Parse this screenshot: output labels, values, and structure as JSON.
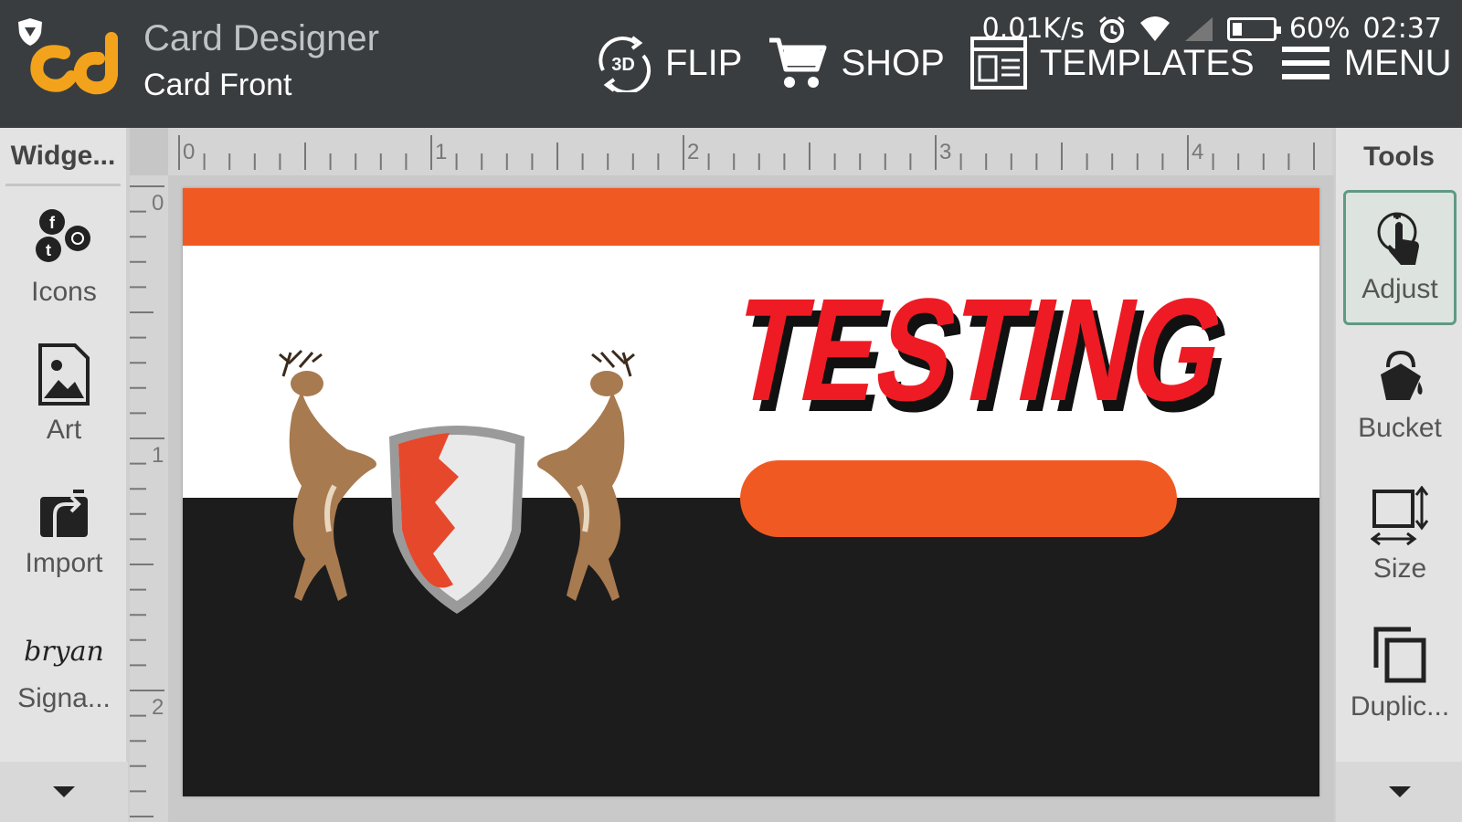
{
  "status": {
    "net_speed": "0.01K/s",
    "battery": "60%",
    "time": "02:37",
    "icons": [
      "shield-icon",
      "alarm-icon",
      "wifi-icon",
      "signal-icon",
      "battery-icon"
    ]
  },
  "app": {
    "title": "Card Designer",
    "subtitle": "Card Front"
  },
  "actions": {
    "flip": "FLIP",
    "flip_badge": "3D",
    "shop": "SHOP",
    "templates": "TEMPLATES",
    "menu": "MENU"
  },
  "widgets": {
    "header": "Widge...",
    "items": [
      {
        "label": "Icons",
        "icon": "social-icons-icon"
      },
      {
        "label": "Art",
        "icon": "image-icon"
      },
      {
        "label": "Import",
        "icon": "import-icon"
      },
      {
        "label": "Signa...",
        "icon": "signature-icon",
        "preview": "bryan"
      }
    ]
  },
  "tools": {
    "header": "Tools",
    "items": [
      {
        "label": "Adjust",
        "icon": "touch-adjust-icon",
        "active": true
      },
      {
        "label": "Bucket",
        "icon": "paint-bucket-icon"
      },
      {
        "label": "Size",
        "icon": "resize-icon"
      },
      {
        "label": "Duplic...",
        "icon": "duplicate-icon"
      }
    ]
  },
  "ruler": {
    "top_labels": [
      "0",
      "1",
      "2",
      "3",
      "4"
    ],
    "left_labels": [
      "0",
      "1",
      "2"
    ]
  },
  "card": {
    "title_text": "TESTING",
    "colors": {
      "accent": "#f05a22",
      "dark": "#1c1c1c",
      "title": "#ee1b24",
      "background": "#ffffff"
    }
  }
}
